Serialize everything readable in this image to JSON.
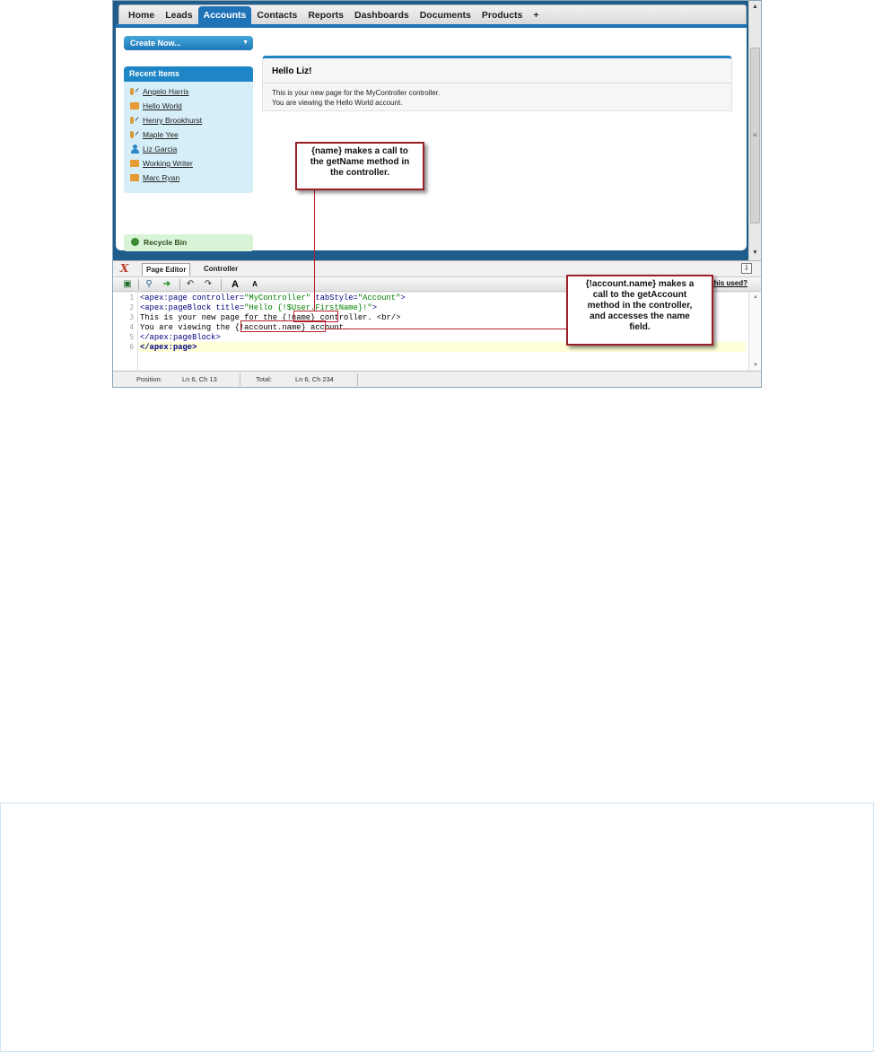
{
  "tabs": [
    "Home",
    "Leads",
    "Accounts",
    "Contacts",
    "Reports",
    "Dashboards",
    "Documents",
    "Products",
    "+"
  ],
  "active_tab": "Accounts",
  "sidebar": {
    "create_new": "Create Now...",
    "recent_title": "Recent Items",
    "recent_items": [
      {
        "label": "Angelo Harris",
        "icon": "contact-icon"
      },
      {
        "label": "Hello World",
        "icon": "account-icon"
      },
      {
        "label": "Henry Brookhurst",
        "icon": "contact-icon"
      },
      {
        "label": "Maple Yee",
        "icon": "contact-icon"
      },
      {
        "label": "Liz Garcia",
        "icon": "user-icon"
      },
      {
        "label": "Working Writer",
        "icon": "account-icon"
      },
      {
        "label": "Marc Ryan",
        "icon": "account-icon"
      }
    ],
    "recycle_bin": "Recycle Bin"
  },
  "main": {
    "title": "Hello Liz!",
    "line1": "This is your new page for the MyController controller.",
    "line2": "You are viewing the Hello World account."
  },
  "editor": {
    "close_glyph": "X",
    "tabs": [
      "Page Editor",
      "Controller"
    ],
    "help_link": "this used?",
    "toolbar_font_large": "A",
    "toolbar_font_small": "A",
    "line_numbers": [
      "1",
      "2",
      "3",
      "4",
      "5",
      "6"
    ],
    "code": {
      "l1_a": "<apex:page controller=",
      "l1_b": "\"MyController\"",
      "l1_c": " tabStyle=",
      "l1_d": "\"Account\"",
      "l1_e": ">",
      "l2_a": "<apex:pageBlock title=",
      "l2_b": "\"Hello {!$User.FirstName}!\"",
      "l2_c": ">",
      "l3_a": "This is your new page for the ",
      "l3_b": "{!name}",
      "l3_c": " controller. <br/>",
      "l4_a": "You are viewing the ",
      "l4_b": "{!account.name}",
      "l4_c": " account.",
      "l5": "</apex:pageBlock>",
      "l6": "</apex:page>"
    },
    "status": {
      "position_label": "Position:",
      "position_value": "Ln 6, Ch 13",
      "total_label": "Total:",
      "total_value": "Ln 6, Ch 234"
    }
  },
  "callouts": {
    "name_lines": [
      "{name} makes a call to",
      "the getName method in",
      "the controller."
    ],
    "account_lines": [
      "{!account.name} makes a",
      "call to the getAccount",
      "method in the controller,",
      "and accesses the name",
      "field."
    ]
  },
  "colors": {
    "accent": "#1f73b7",
    "callout_border": "#9b1f26",
    "recycle_bg": "#d9f3d6"
  }
}
